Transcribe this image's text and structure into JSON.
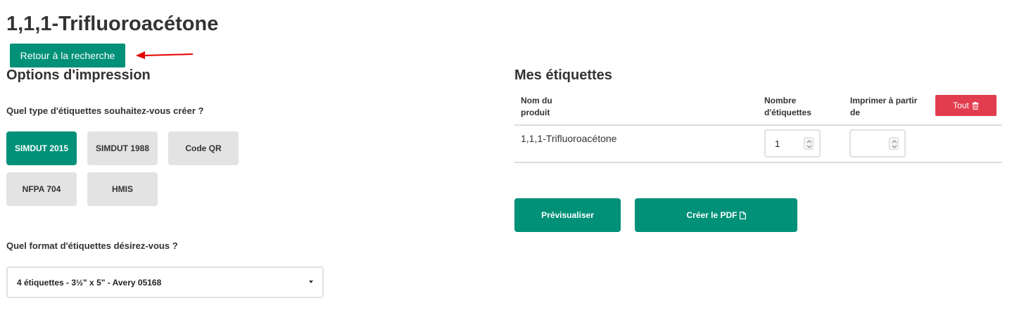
{
  "page": {
    "title": "1,1,1-Trifluoroacétone",
    "back_label": "Retour à la recherche"
  },
  "options": {
    "title": "Options d'impression",
    "type_question": "Quel type d'étiquettes souhaitez-vous créer ?",
    "types": [
      "SIMDUT 2015",
      "SIMDUT 1988",
      "Code QR",
      "NFPA 704",
      "HMIS"
    ],
    "selected_type": "SIMDUT 2015",
    "format_question": "Quel format d'étiquettes désirez-vous ?",
    "format_selected": "4 étiquettes - 3½\" x 5\" - Avery 05168"
  },
  "labels": {
    "title": "Mes étiquettes",
    "col_name_1": "Nom du",
    "col_name_2": "produit",
    "col_count_1": "Nombre",
    "col_count_2": "d'étiquettes",
    "col_start_1": "Imprimer à partir",
    "col_start_2": "de",
    "all_label": "Tout",
    "rows": [
      {
        "name": "1,1,1-Trifluoroacétone",
        "count": "1",
        "start": ""
      }
    ],
    "preview_label": "Prévisualiser",
    "pdf_label": "Créer le PDF"
  },
  "colors": {
    "accent": "#009178",
    "danger": "#e23d4f",
    "annotation_arrow": "#e60000"
  },
  "icons": {
    "all_button": "trash-icon",
    "pdf_button": "file-icon",
    "format_select": "caret-down-icon"
  }
}
